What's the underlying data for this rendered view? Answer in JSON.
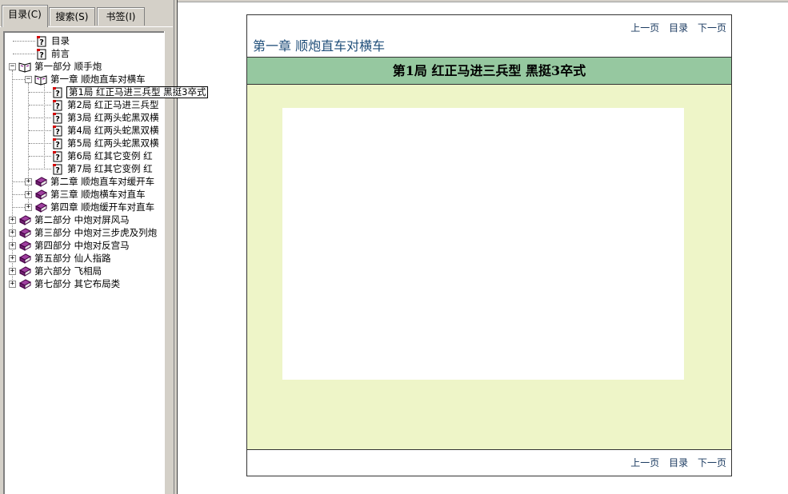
{
  "tabs": [
    "目录(C)",
    "搜索(S)",
    "书签(I)"
  ],
  "tree": {
    "items": [
      {
        "label": "目录",
        "icon": "question-page-icon"
      },
      {
        "label": "前言",
        "icon": "question-page-icon"
      },
      {
        "label": "第一部分  顺手炮",
        "icon": "open-book-icon",
        "expander": "−"
      },
      {
        "label": "第一章  顺炮直车对横车",
        "icon": "open-book-icon",
        "expander": "−"
      },
      {
        "label": "第1局  红正马进三兵型  黑挺3卒式",
        "icon": "question-page-icon",
        "selected": true
      },
      {
        "label": "第2局  红正马进三兵型",
        "icon": "question-page-icon"
      },
      {
        "label": "第3局  红两头蛇黑双横",
        "icon": "question-page-icon"
      },
      {
        "label": "第4局  红两头蛇黑双横",
        "icon": "question-page-icon"
      },
      {
        "label": "第5局  红两头蛇黑双横",
        "icon": "question-page-icon"
      },
      {
        "label": "第6局  红其它变例  红",
        "icon": "question-page-icon"
      },
      {
        "label": "第7局  红其它变例  红",
        "icon": "question-page-icon"
      },
      {
        "label": "第二章  顺炮直车对缓开车",
        "icon": "closed-book-icon",
        "expander": "+"
      },
      {
        "label": "第三章  顺炮横车对直车",
        "icon": "closed-book-icon",
        "expander": "+"
      },
      {
        "label": "第四章  顺炮缓开车对直车",
        "icon": "closed-book-icon",
        "expander": "+"
      },
      {
        "label": "第二部分  中炮对屏风马",
        "icon": "closed-book-icon",
        "expander": "+"
      },
      {
        "label": "第三部分  中炮对三步虎及列炮",
        "icon": "closed-book-icon",
        "expander": "+"
      },
      {
        "label": "第四部分  中炮对反宫马",
        "icon": "closed-book-icon",
        "expander": "+"
      },
      {
        "label": "第五部分  仙人指路",
        "icon": "closed-book-icon",
        "expander": "+"
      },
      {
        "label": "第六部分  飞相局",
        "icon": "closed-book-icon",
        "expander": "+"
      },
      {
        "label": "第七部分  其它布局类",
        "icon": "closed-book-icon",
        "expander": "+"
      }
    ]
  },
  "content": {
    "nav": {
      "prev": "上一页",
      "toc": "目录",
      "next": "下一页"
    },
    "chapter_title": "第一章  顺炮直车对横车",
    "game_title": "第1局  红正马进三兵型  黑挺3卒式"
  },
  "colors": {
    "title_bar": "#96c8a0",
    "content_bg": "#eef5c8",
    "link": "#17375e",
    "window_face": "#d4d0c8"
  }
}
